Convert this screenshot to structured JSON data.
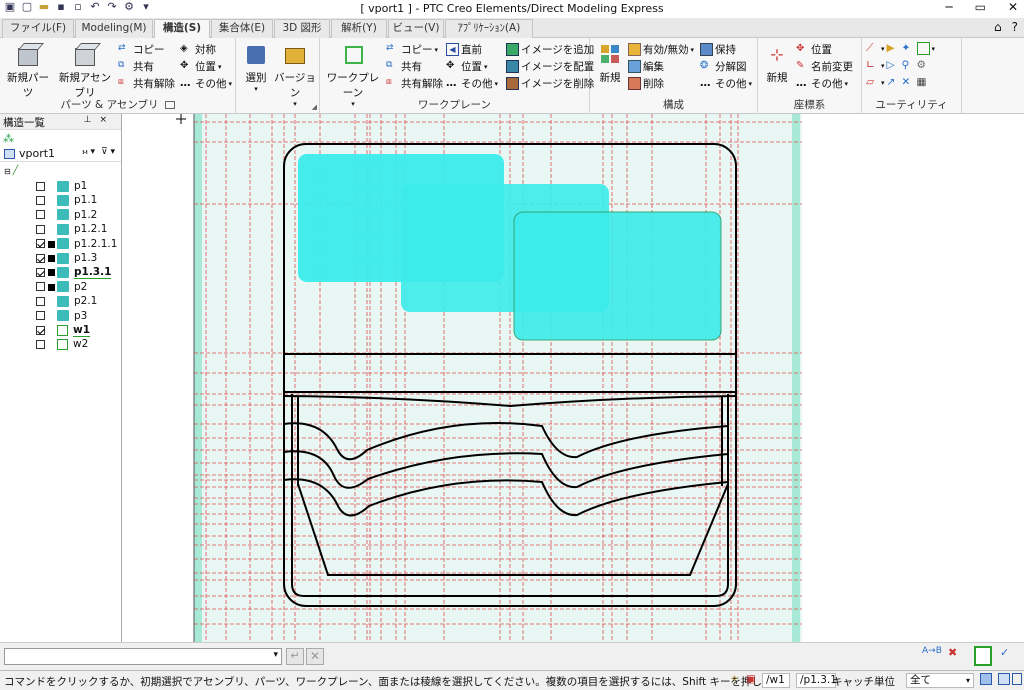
{
  "title": "[ vport1 ] - PTC Creo Elements/Direct Modeling Express",
  "tabs": [
    {
      "label": "ファイル(F)"
    },
    {
      "label": "Modeling(M)"
    },
    {
      "label": "構造(S)"
    },
    {
      "label": "集合体(E)"
    },
    {
      "label": "3D 図形"
    },
    {
      "label": "解析(Y)"
    },
    {
      "label": "ビュー(V)"
    },
    {
      "label": "ｱﾌﾟﾘｹｰｼｮﾝ(A)"
    }
  ],
  "ribbon": {
    "parts": {
      "label": "パーツ & アセンブリ",
      "new_part": "新規パーツ",
      "new_assembly": "新規アセンブリ",
      "copy": "コピー",
      "share": "共有",
      "unshare": "共有解除",
      "symmetry": "対称",
      "position": "位置",
      "other": "その他",
      "select": "選別",
      "version": "バージョン"
    },
    "workplane": {
      "label": "ワークプレーン",
      "workplane": "ワークプレーン",
      "copy": "コピー",
      "share": "共有",
      "unshare": "共有解除",
      "previous": "直前",
      "position": "位置",
      "other": "その他",
      "add_image": "イメージを追加",
      "place_image": "イメージを配置",
      "delete_image": "イメージを削除"
    },
    "config": {
      "label": "構成",
      "new": "新規",
      "enable_disable": "有効/無効",
      "edit": "編集",
      "delete": "削除",
      "keep": "保持",
      "exploded": "分解図",
      "other": "その他"
    },
    "coords": {
      "label": "座標系",
      "new": "新規",
      "position": "位置",
      "rename": "名前変更",
      "other": "その他"
    },
    "utility": {
      "label": "ユーティリティ"
    }
  },
  "tree": {
    "header": "構造一覧",
    "viewport": "vport1",
    "items": [
      {
        "name": "p1",
        "type": "part",
        "checked": false,
        "locked": false,
        "bold": false
      },
      {
        "name": "p1.1",
        "type": "part",
        "checked": false,
        "locked": false,
        "bold": false
      },
      {
        "name": "p1.2",
        "type": "part",
        "checked": false,
        "locked": false,
        "bold": false
      },
      {
        "name": "p1.2.1",
        "type": "part",
        "checked": false,
        "locked": false,
        "bold": false
      },
      {
        "name": "p1.2.1.1",
        "type": "part",
        "checked": true,
        "locked": true,
        "bold": false
      },
      {
        "name": "p1.3",
        "type": "part",
        "checked": true,
        "locked": true,
        "bold": false
      },
      {
        "name": "p1.3.1",
        "type": "part",
        "checked": true,
        "locked": true,
        "bold": true
      },
      {
        "name": "p2",
        "type": "part",
        "checked": false,
        "locked": true,
        "bold": false
      },
      {
        "name": "p2.1",
        "type": "part",
        "checked": false,
        "locked": false,
        "bold": false
      },
      {
        "name": "p3",
        "type": "part",
        "checked": false,
        "locked": false,
        "bold": false
      },
      {
        "name": "w1",
        "type": "workplane",
        "checked": true,
        "locked": false,
        "bold": true
      },
      {
        "name": "w2",
        "type": "workplane",
        "checked": false,
        "locked": false,
        "bold": false
      }
    ]
  },
  "status": {
    "message": "コマンドをクリックするか、初期選択でアセンブリ、パーツ、ワークプレーン、面または稜線を選択してください。複数の項目を選択するには、Shift キーを押します",
    "workplane": "/w1",
    "part": "/p1.3.1",
    "catch": "キャッチ",
    "unit": "単位",
    "filter": "全て"
  },
  "colors": {
    "canvas": "#e8f7f3",
    "grid": "#e05050",
    "image": "#3cebeb",
    "margin": "#a8e8d6"
  }
}
